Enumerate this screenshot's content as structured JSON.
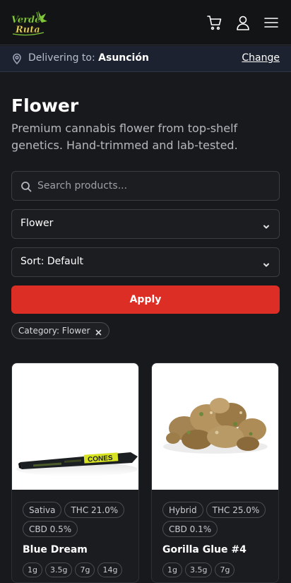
{
  "header": {
    "logo_text": "Verde Ruta",
    "cart_icon": "cart-icon",
    "account_icon": "user-icon",
    "menu_icon": "hamburger-menu-icon"
  },
  "delivery": {
    "prefix": "Delivering to:",
    "city": "Asunción",
    "change_label": "Change"
  },
  "page": {
    "title": "Flower",
    "description": "Premium cannabis flower from top-shelf genetics. Hand-trimmed and lab-tested."
  },
  "filters": {
    "search_placeholder": "Search products...",
    "category_selected": "Flower",
    "sort_selected": "Sort: Default",
    "apply_label": "Apply",
    "active_chip": "Category: Flower"
  },
  "products": [
    {
      "name": "Blue Dream",
      "type": "Sativa",
      "thc": "THC 21.0%",
      "cbd": "CBD 0.5%",
      "weights": [
        "1g",
        "3.5g",
        "7g",
        "14g"
      ],
      "image_label": "CONES"
    },
    {
      "name": "Gorilla Glue #4",
      "type": "Hybrid",
      "thc": "THC 25.0%",
      "cbd": "CBD 0.1%",
      "weights": [
        "1g",
        "3.5g",
        "7g"
      ]
    }
  ],
  "colors": {
    "accent": "#dc2e24",
    "background": "#17191c",
    "logo_green": "#7fc63a"
  }
}
